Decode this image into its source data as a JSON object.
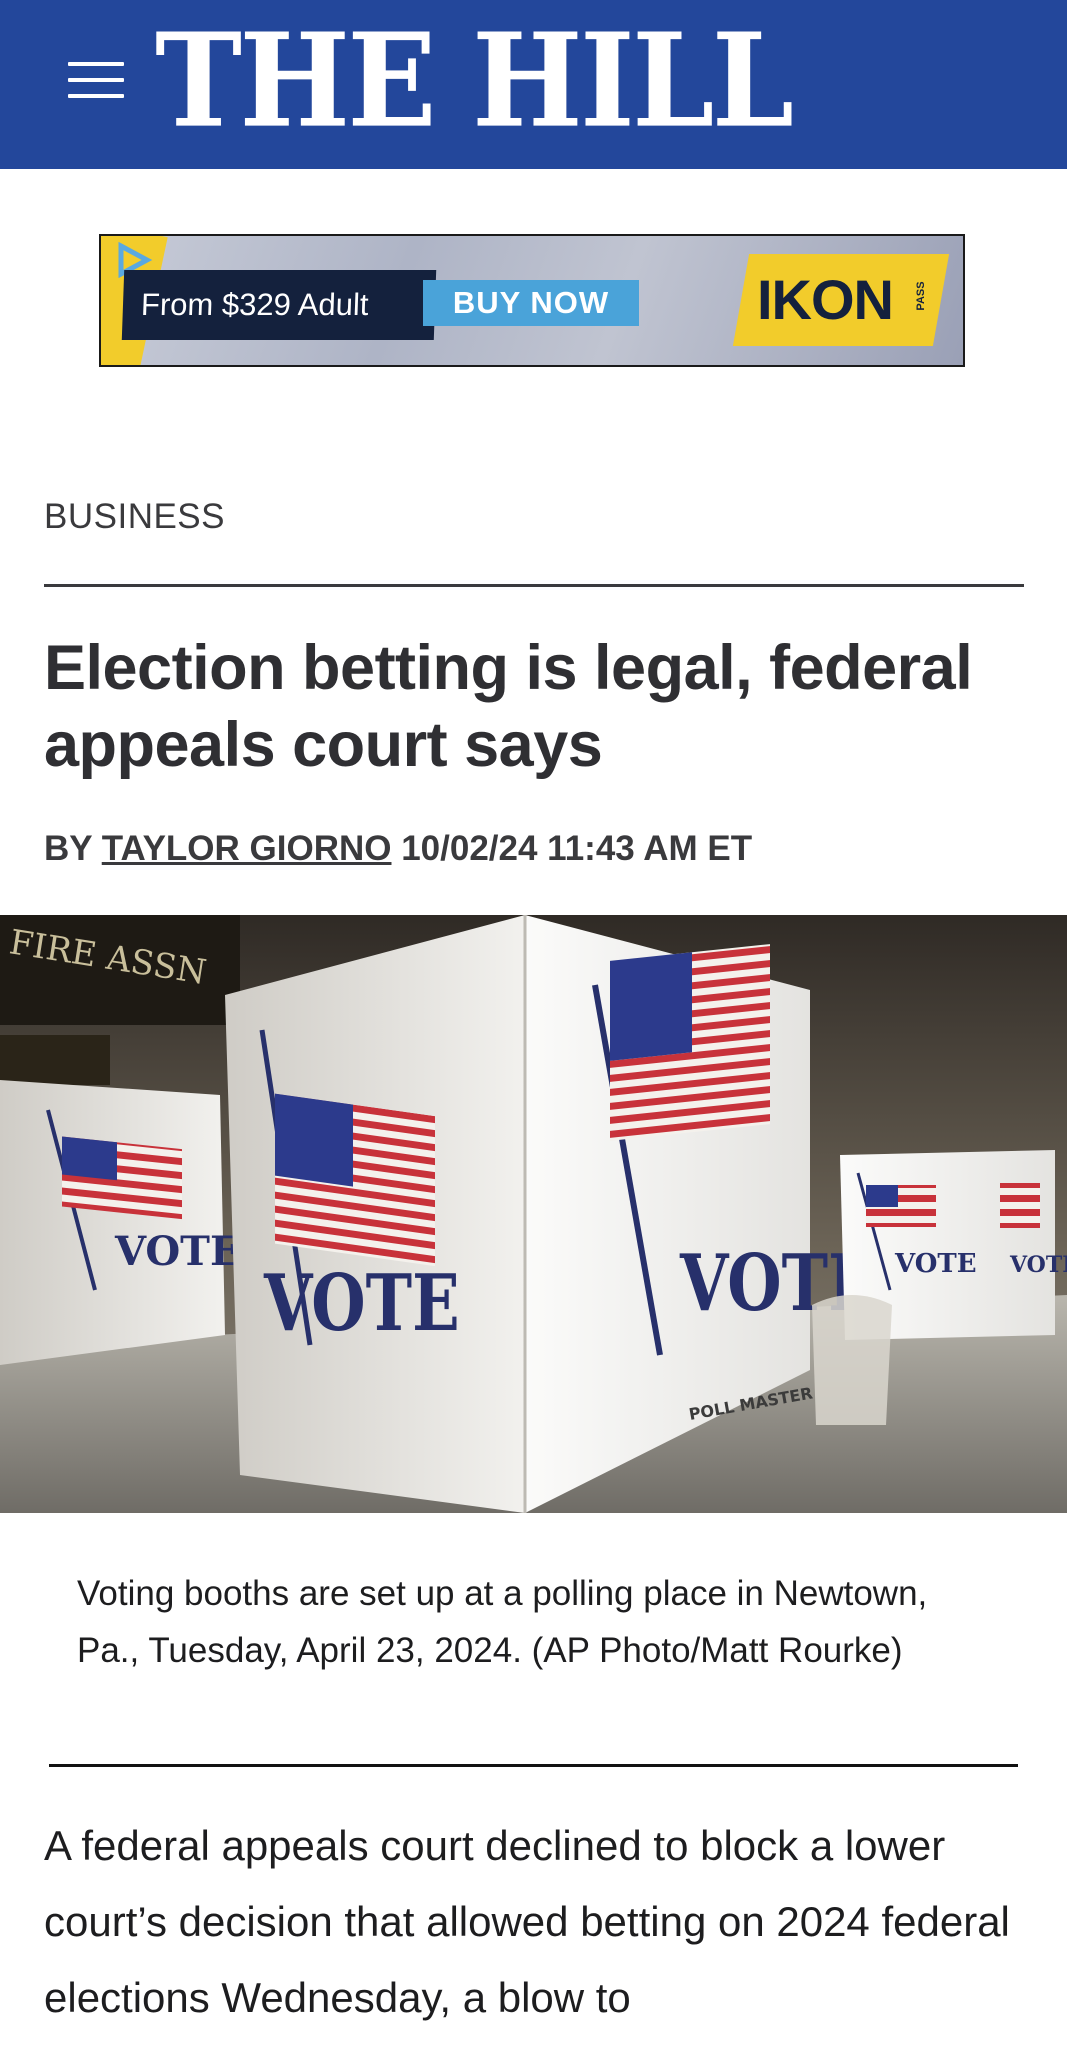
{
  "header": {
    "logo_text": "THE HILL",
    "menu_icon": "hamburger-menu-icon",
    "background_color": "#23479b"
  },
  "ad": {
    "price_text": "From $329 Adult",
    "cta_label": "BUY NOW",
    "brand_text": "IKON",
    "brand_subtext": "PASS"
  },
  "article": {
    "section": "BUSINESS",
    "headline": "Election betting is legal, federal appeals court says",
    "byline_prefix": "BY",
    "author": "TAYLOR GIORNO",
    "timestamp": "10/02/24 11:43 AM ET",
    "image_alt": "Voting booths with American flags and VOTE printed on them",
    "image_texts": {
      "booth_vote": "VOTE",
      "wall_sign": "FIRE ASSN",
      "booth_brand": "POLL MASTER"
    },
    "caption": "Voting booths are set up at a polling place in Newtown, Pa., Tuesday, April 23, 2024. (AP Photo/Matt Rourke)",
    "body_first_paragraph": "A federal appeals court declined to block a lower court’s decision that allowed betting on 2024 federal elections Wednesday, a blow to"
  }
}
